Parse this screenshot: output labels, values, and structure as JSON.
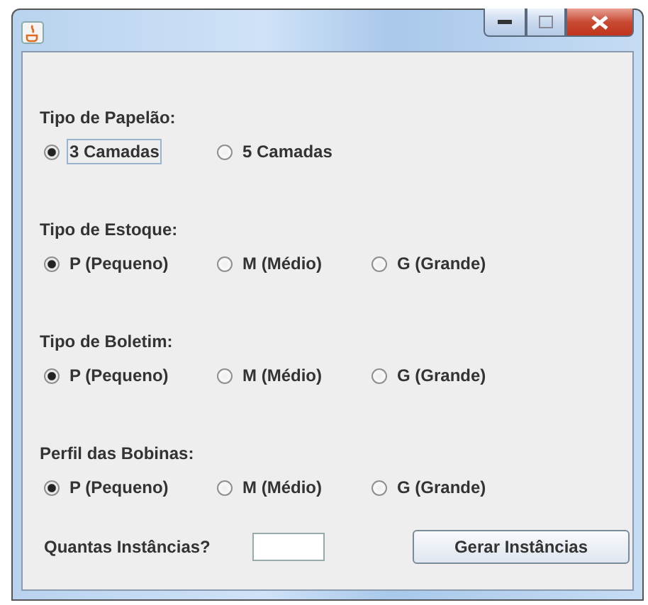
{
  "groups": [
    {
      "title": "Tipo de Papelão:",
      "options": [
        {
          "label": "3 Camadas",
          "selected": true,
          "focused": true
        },
        {
          "label": "5 Camadas",
          "selected": false,
          "focused": false
        }
      ]
    },
    {
      "title": "Tipo de Estoque:",
      "options": [
        {
          "label": "P (Pequeno)",
          "selected": true,
          "focused": false
        },
        {
          "label": "M (Médio)",
          "selected": false,
          "focused": false
        },
        {
          "label": "G (Grande)",
          "selected": false,
          "focused": false
        }
      ]
    },
    {
      "title": "Tipo de Boletim:",
      "options": [
        {
          "label": "P (Pequeno)",
          "selected": true,
          "focused": false
        },
        {
          "label": "M (Médio)",
          "selected": false,
          "focused": false
        },
        {
          "label": "G (Grande)",
          "selected": false,
          "focused": false
        }
      ]
    },
    {
      "title": "Perfil das Bobinas:",
      "options": [
        {
          "label": "P (Pequeno)",
          "selected": true,
          "focused": false
        },
        {
          "label": "M (Médio)",
          "selected": false,
          "focused": false
        },
        {
          "label": "G (Grande)",
          "selected": false,
          "focused": false
        }
      ]
    }
  ],
  "instances": {
    "label": "Quantas Instâncias?"
  },
  "button": "Gerar Instâncias"
}
